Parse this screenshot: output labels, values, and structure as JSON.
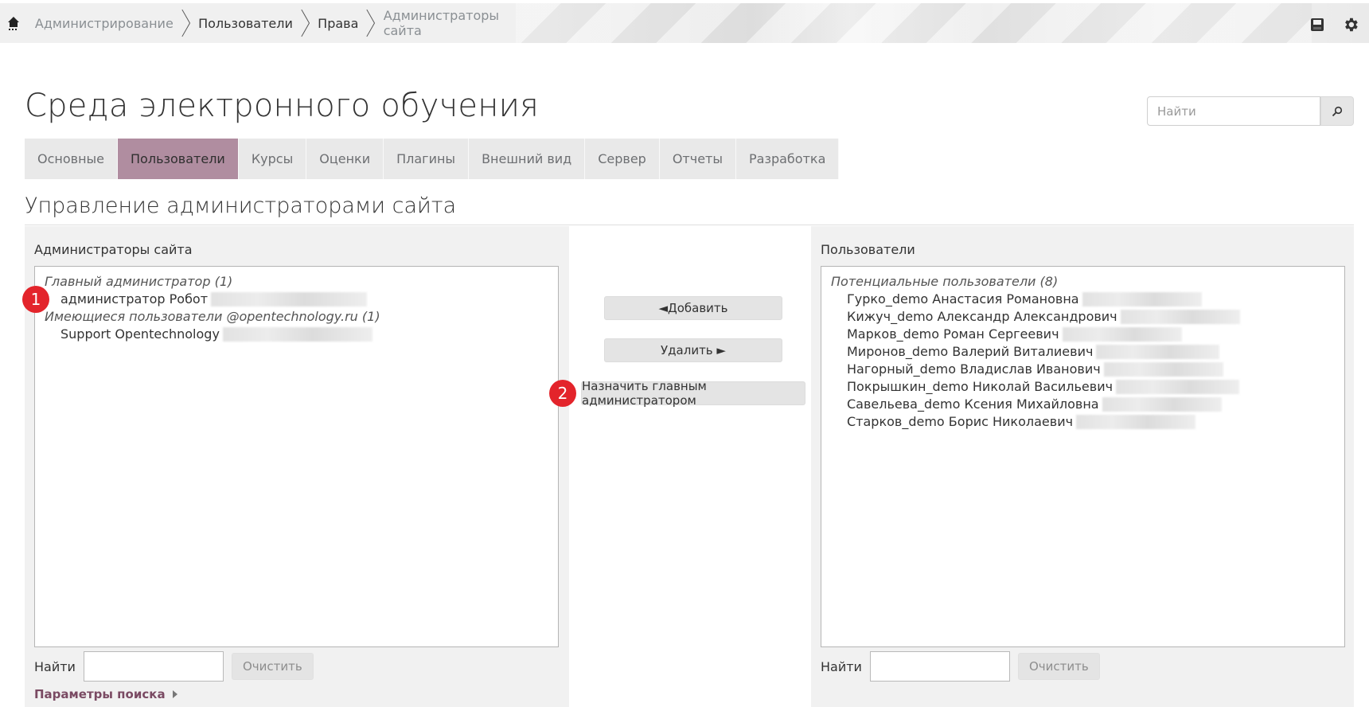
{
  "breadcrumb": {
    "home_icon": "home-icon",
    "items": [
      {
        "label": "Администрирование",
        "style": "dim"
      },
      {
        "label": "Пользователи",
        "style": "dark"
      },
      {
        "label": "Права",
        "style": "dark"
      },
      {
        "label": "Администраторы сайта",
        "style": "dim"
      }
    ]
  },
  "top_icons": [
    "save-icon",
    "gear-icon"
  ],
  "site_title": "Среда электронного обучения",
  "search": {
    "placeholder": "Найти",
    "button_icon": "search-icon"
  },
  "tabs": [
    {
      "label": "Основные",
      "active": false
    },
    {
      "label": "Пользователи",
      "active": true
    },
    {
      "label": "Курсы",
      "active": false
    },
    {
      "label": "Оценки",
      "active": false
    },
    {
      "label": "Плагины",
      "active": false
    },
    {
      "label": "Внешний вид",
      "active": false
    },
    {
      "label": "Сервер",
      "active": false
    },
    {
      "label": "Отчеты",
      "active": false
    },
    {
      "label": "Разработка",
      "active": false
    }
  ],
  "section_title": "Управление администраторами сайта",
  "left_panel": {
    "label": "Администраторы сайта",
    "groups": [
      {
        "name": "Главный администратор (1)",
        "users": [
          "администратор Робот"
        ]
      },
      {
        "name": "Имеющиеся пользователи @opentechnology.ru (1)",
        "users": [
          "Support Opentechnology"
        ]
      }
    ],
    "find_label": "Найти",
    "clear_label": "Очистить",
    "search_params_label": "Параметры поиска"
  },
  "right_panel": {
    "label": "Пользователи",
    "group": "Потенциальные пользователи (8)",
    "users": [
      "Гурко_demo Анастасия Романовна",
      "Кижуч_demo Александр Александрович",
      "Марков_demo Роман Сергеевич",
      "Миронов_demo Валерий Виталиевич",
      "Нагорный_demo Владислав Иванович",
      "Покрышкин_demo Николай Васильевич",
      "Савельева_demo Ксения Михайловна",
      "Старков_demo Борис Николаевич"
    ],
    "find_label": "Найти",
    "clear_label": "Очистить"
  },
  "actions": {
    "add": "◄Добавить",
    "remove": "Удалить ►",
    "make_main_admin": "Назначить главным администратором"
  },
  "markers": [
    "1",
    "2"
  ],
  "colors": {
    "active_tab": "#b08da0",
    "marker": "#e3242b",
    "link": "#7a4a63"
  }
}
